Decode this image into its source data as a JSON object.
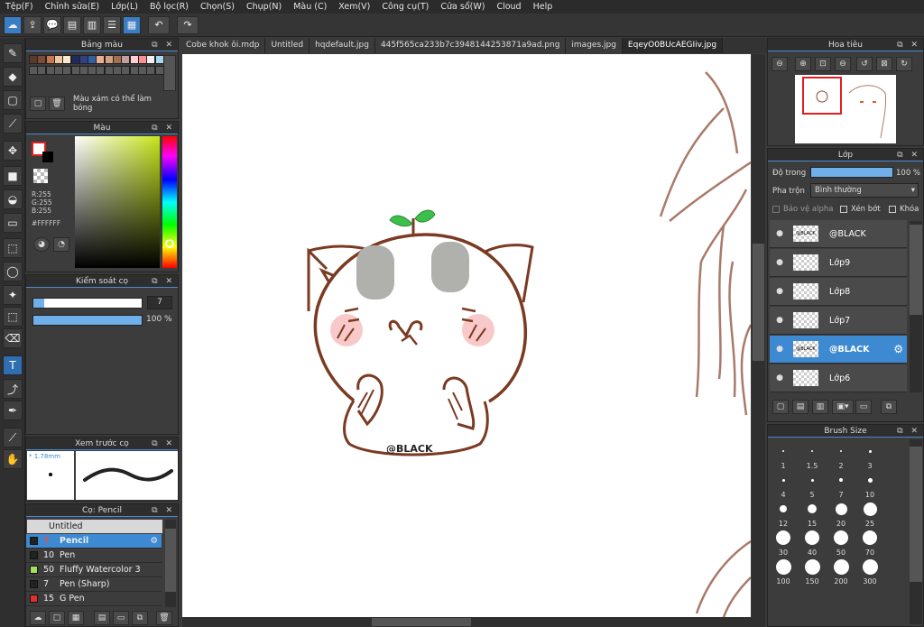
{
  "menu": [
    "Tệp(F)",
    "Chỉnh sửa(E)",
    "Lớp(L)",
    "Bộ lọc(R)",
    "Chọn(S)",
    "Chụp(N)",
    "Màu (C)",
    "Xem(V)",
    "Công cụ(T)",
    "Cửa sổ(W)",
    "Cloud",
    "Help"
  ],
  "panels": {
    "palette": {
      "title": "Bảng màu",
      "note": "Màu xám có thể làm bóng"
    },
    "color": {
      "title": "Màu",
      "r": "R:255",
      "g": "G:255",
      "b": "B:255",
      "hex": "#FFFFFF"
    },
    "brush_control": {
      "title": "Kiểm soát cọ",
      "size": "7",
      "opacity": "100 %"
    },
    "preview": {
      "title": "Xem trước cọ",
      "size": "* 1.78mm"
    },
    "brush": {
      "title": "Cọ: Pencil",
      "group": "Untitled"
    },
    "navigator": {
      "title": "Hoa tiêu"
    },
    "layers": {
      "title": "Lớp",
      "opacity_label": "Độ trong",
      "opacity_value": "100 %",
      "blend_label": "Pha trộn",
      "blend_value": "Bình thường",
      "protect_alpha": "Bảo vệ alpha",
      "clipping": "Xén bớt",
      "lock": "Khóa"
    },
    "brush_size": {
      "title": "Brush Size"
    }
  },
  "tabs": [
    "Cobe khok ôi.mdp",
    "Untitled",
    "hqdefault.jpg",
    "445f565ca233b7c3948144253871a9ad.png",
    "images.jpg",
    "EqeyO0BUcAEGIiv.jpg"
  ],
  "active_tab": 5,
  "layers": [
    {
      "name": "@BLACK",
      "thumb": "@BLACK"
    },
    {
      "name": "Lớp9",
      "thumb": ""
    },
    {
      "name": "Lớp8",
      "thumb": ""
    },
    {
      "name": "Lớp7",
      "thumb": ""
    },
    {
      "name": "@BLACK",
      "thumb": "@BLACK",
      "selected": true
    },
    {
      "name": "Lớp6",
      "thumb": ""
    }
  ],
  "brushes": [
    {
      "size": "7",
      "name": "Pencil",
      "color": "#222222",
      "selected": true
    },
    {
      "size": "10",
      "name": "Pen",
      "color": "#222222"
    },
    {
      "size": "50",
      "name": "Fluffy Watercolor 3",
      "color": "#a6e05a"
    },
    {
      "size": "7",
      "name": "Pen (Sharp)",
      "color": "#222222"
    },
    {
      "size": "15",
      "name": "G Pen",
      "color": "#e23030"
    }
  ],
  "brush_sizes": [
    "1",
    "1.5",
    "2",
    "3",
    "4",
    "5",
    "7",
    "10",
    "12",
    "15",
    "20",
    "25",
    "30",
    "40",
    "50",
    "70",
    "100",
    "150",
    "200",
    "300"
  ],
  "canvas_text": "@BLACK",
  "colors": {
    "accent": "#3d8ad2",
    "drawing_stroke": "#7b3a22",
    "blush": "#f9c9c9",
    "ear_grey": "#b0b0ad",
    "sprout": "#3dbf4b",
    "palette": [
      "#5a3a2a",
      "#7a4a3a",
      "#c87850",
      "#f0c8a0",
      "#ffe8d0",
      "#202a60",
      "#304080",
      "#3060a0",
      "#e8b090",
      "#d0a080",
      "#a07050",
      "#c0a0a0",
      "#ffd0d0",
      "#ff9090",
      "#f0f0f0",
      "#a8d8f0"
    ]
  }
}
